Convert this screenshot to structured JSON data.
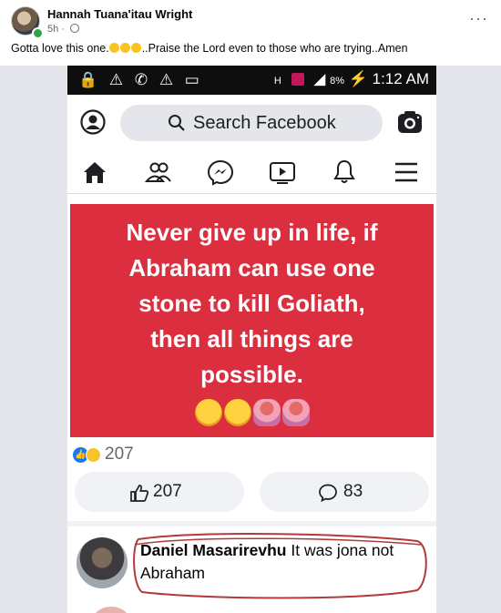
{
  "post": {
    "author": "Hannah Tuana'itau Wright",
    "time": "5h",
    "caption_text": "Gotta love this one.",
    "caption_tail": "..Praise the Lord even to those who are trying..Amen",
    "more_label": "···"
  },
  "screenshot": {
    "status_bar": {
      "left_icons": "🔒 ⚠ ✆ ⚠ ▭",
      "network": "H",
      "battery": "8%",
      "time": "1:12 AM"
    },
    "search_placeholder": "Search Facebook",
    "nav_icons": [
      "home-icon",
      "friends-icon",
      "messenger-icon",
      "watch-icon",
      "notifications-icon",
      "menu-icon"
    ],
    "banner_lines": [
      "Never give up in life, if",
      "Abraham can use one",
      "stone to kill Goliath,",
      "then all things are",
      "possible."
    ],
    "reaction_count": "207",
    "like_label": "207",
    "comment_label": "83",
    "comment": {
      "name": "Daniel Masarirevhu",
      "text": "It was jona not Abraham"
    },
    "colors": {
      "banner": "#db2f3f",
      "facebook_blue": "#1877f2",
      "circle_annotation": "#b23a3a"
    }
  }
}
